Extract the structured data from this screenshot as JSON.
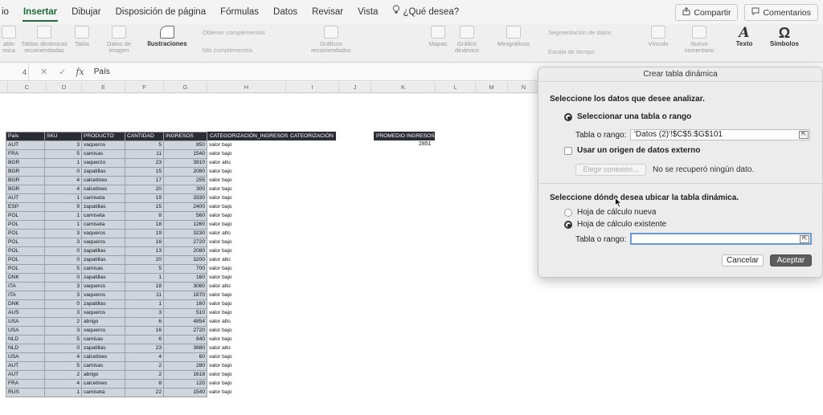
{
  "menu": {
    "items": [
      "io",
      "Insertar",
      "Dibujar",
      "Disposición de página",
      "Fórmulas",
      "Datos",
      "Revisar",
      "Vista"
    ],
    "active_index": 1,
    "search_label": "¿Qué desea?",
    "share_label": "Compartir",
    "comments_label": "Comentarios"
  },
  "ribbon": {
    "groups": [
      {
        "label": "ablo\nmica",
        "disabled": true
      },
      {
        "label": "Tablas dinámicas\nrecomendadas",
        "disabled": true
      },
      {
        "label": "Tabla",
        "disabled": true
      },
      {
        "label": "Datos de\nimagen",
        "disabled": true
      },
      {
        "label": "Ilustraciones",
        "disabled": false
      },
      {
        "label": "Gráficos\nrecomendados",
        "disabled": true
      },
      {
        "label": "Mapas",
        "disabled": true
      },
      {
        "label": "Gráfico\ndinámico",
        "disabled": true
      },
      {
        "label": "Minigráficos",
        "disabled": true
      },
      {
        "label": "Vínculo",
        "disabled": true
      },
      {
        "label": "Nuevo\ncomentario",
        "disabled": true
      },
      {
        "label": "Texto",
        "disabled": false
      },
      {
        "label": "Símbolos",
        "disabled": false
      }
    ],
    "small_items": [
      "Obtener complementos",
      "Mis complementos",
      "Segmentación de datos",
      "Escala de tiempo"
    ]
  },
  "formula_bar": {
    "cell_ref": "4",
    "fx": "fx",
    "value": "País"
  },
  "columns": [
    "C",
    "D",
    "E",
    "F",
    "G",
    "H",
    "I",
    "J",
    "K",
    "L",
    "M",
    "N"
  ],
  "table": {
    "headers": [
      "País",
      "SKU",
      "PRODUCTO",
      "CANTIDAD",
      "INGRESOS"
    ],
    "extra_headers": [
      "CATEGORIZACIÓN_INGRESOS",
      "CATEORIZACIÓN",
      "PROMEDIO INGRESOS"
    ],
    "promedio_value": "2851",
    "rows": [
      [
        "AUT",
        "3",
        "vaqueros",
        "5",
        "850",
        "valor bajo"
      ],
      [
        "FRA",
        "5",
        "camisas",
        "11",
        "1540",
        "valor bajo"
      ],
      [
        "BGR",
        "1",
        "vaquerzo",
        "23",
        "3910",
        "valor alto"
      ],
      [
        "BGR",
        "0",
        "zapatillas",
        "15",
        "2080",
        "valor bajo"
      ],
      [
        "BGR",
        "4",
        "calcetines",
        "17",
        "255",
        "valor bajo"
      ],
      [
        "BGR",
        "4",
        "calcetines",
        "20",
        "300",
        "valor bajo"
      ],
      [
        "AUT",
        "1",
        "camiseta",
        "19",
        "3330",
        "valor bajo"
      ],
      [
        "ESP",
        "9",
        "zapatillas",
        "15",
        "2400",
        "valor bajo"
      ],
      [
        "POL",
        "1",
        "camiseta",
        "8",
        "560",
        "valor bajo"
      ],
      [
        "POL",
        "1",
        "camiseta",
        "18",
        "1260",
        "valor bajo"
      ],
      [
        "POL",
        "3",
        "vaqueros",
        "19",
        "3230",
        "valor alto"
      ],
      [
        "POL",
        "3",
        "vaqueros",
        "16",
        "2720",
        "valor bajo"
      ],
      [
        "POL",
        "0",
        "zapatillas",
        "13",
        "2080",
        "valor bajo"
      ],
      [
        "POL",
        "0",
        "zapatillas",
        "20",
        "3200",
        "valor alto"
      ],
      [
        "POL",
        "5",
        "camisas",
        "5",
        "700",
        "valor bajo"
      ],
      [
        "DNK",
        "0",
        "zapatillas",
        "1",
        "160",
        "valor bajo"
      ],
      [
        "ITA",
        "3",
        "vaqueros",
        "18",
        "3060",
        "valor alto"
      ],
      [
        "ITA",
        "3",
        "vaqueros",
        "11",
        "1870",
        "valor bajo"
      ],
      [
        "DNK",
        "0",
        "zapatillas",
        "1",
        "160",
        "valor bajo"
      ],
      [
        "AUS",
        "3",
        "vaqueros",
        "3",
        "510",
        "valor bajo"
      ],
      [
        "USA",
        "2",
        "abrigo",
        "6",
        "4854",
        "valor alto"
      ],
      [
        "USA",
        "3",
        "vaqueros",
        "16",
        "2720",
        "valor bajo"
      ],
      [
        "NLD",
        "5",
        "camisas",
        "6",
        "840",
        "valor bajo"
      ],
      [
        "NLD",
        "0",
        "zapatillas",
        "23",
        "3680",
        "valor alto"
      ],
      [
        "USA",
        "4",
        "calcetines",
        "4",
        "60",
        "valor bajo"
      ],
      [
        "AUT",
        "5",
        "camisas",
        "2",
        "280",
        "valor bajo"
      ],
      [
        "AUT",
        "2",
        "abrigo",
        "2",
        "1618",
        "valor bajo"
      ],
      [
        "FRA",
        "4",
        "calcetines",
        "8",
        "120",
        "valor bajo"
      ],
      [
        "RUS",
        "1",
        "camiseta",
        "22",
        "1540",
        "valor bajo"
      ]
    ]
  },
  "dialog": {
    "title": "Crear tabla dinámica",
    "section1": "Seleccione los datos que desee analizar.",
    "radio_table_label": "Seleccionar una tabla o rango",
    "range_label": "Tabla o rango:",
    "range_value": "'Datos (2)'!$C$5:$G$101",
    "external_label": "Usar un origen de datos externo",
    "choose_connection": "Elegir conexión...",
    "no_data": "No se recuperó ningún dato.",
    "section2": "Seleccione dónde desea ubicar la tabla dinámica.",
    "radio_new_label": "Hoja de cálculo nueva",
    "radio_existing_label": "Hoja de cálculo existente",
    "dest_label": "Tabla o rango:",
    "dest_value": "",
    "cancel": "Cancelar",
    "accept": "Aceptar"
  }
}
